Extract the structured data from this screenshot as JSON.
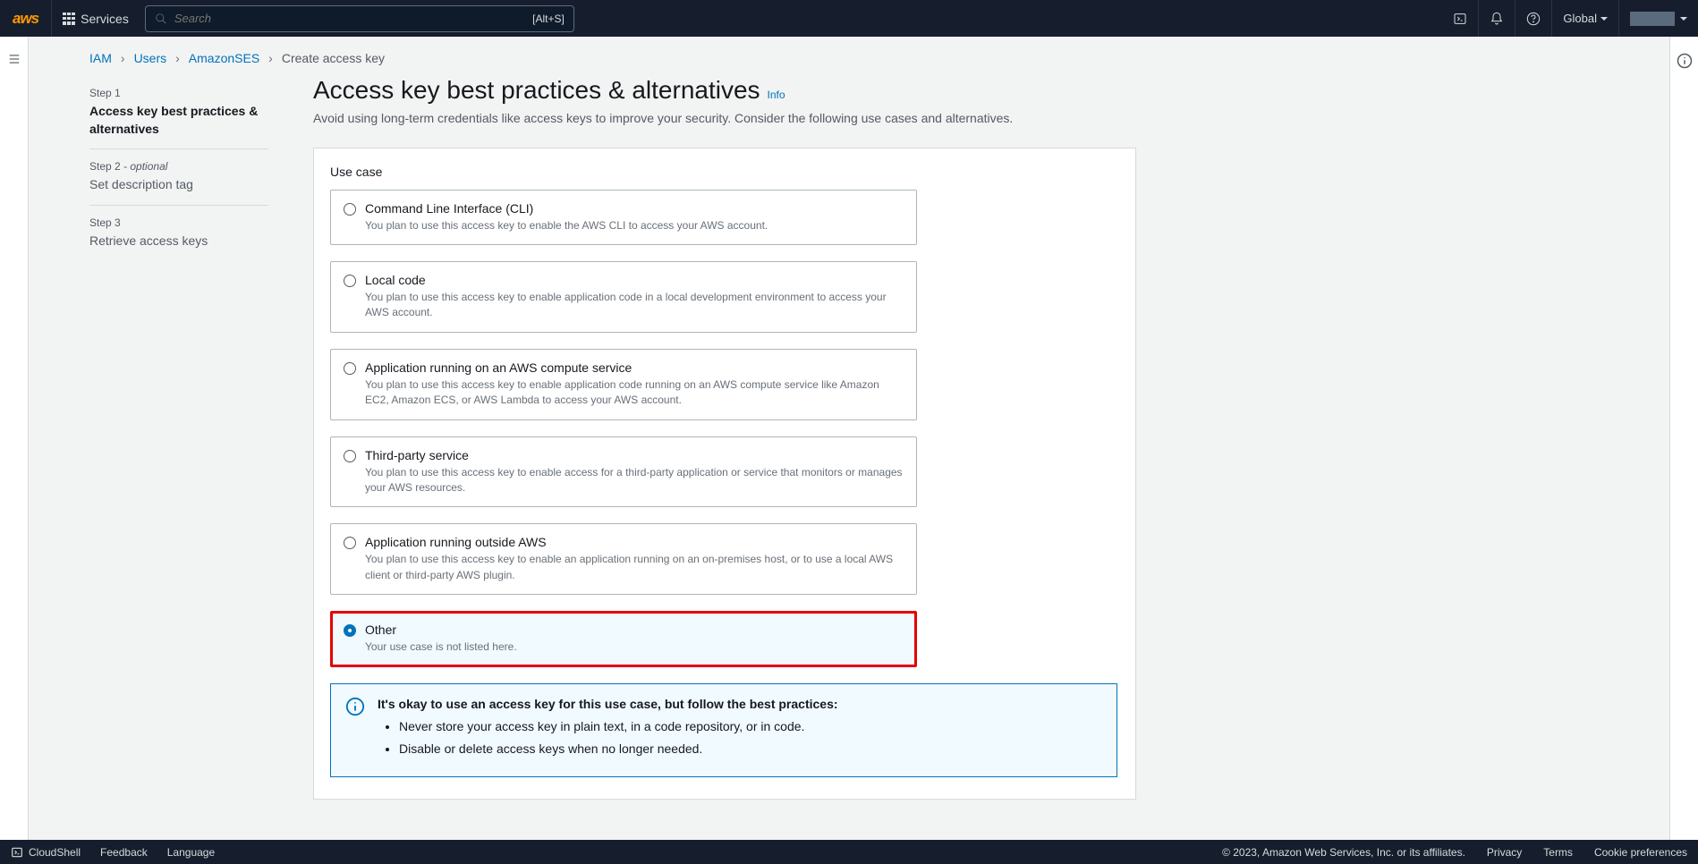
{
  "nav": {
    "logo_text": "aws",
    "services_label": "Services",
    "search_placeholder": "Search",
    "search_shortcut": "[Alt+S]",
    "region_label": "Global"
  },
  "breadcrumb": {
    "items": [
      "IAM",
      "Users",
      "AmazonSES"
    ],
    "current": "Create access key"
  },
  "steps": [
    {
      "num": "Step 1",
      "optional": "",
      "title": "Access key best practices & alternatives",
      "active": true
    },
    {
      "num": "Step 2",
      "optional": " - optional",
      "title": "Set description tag",
      "active": false
    },
    {
      "num": "Step 3",
      "optional": "",
      "title": "Retrieve access keys",
      "active": false
    }
  ],
  "page": {
    "title": "Access key best practices & alternatives",
    "info_label": "Info",
    "description": "Avoid using long-term credentials like access keys to improve your security. Consider the following use cases and alternatives."
  },
  "use_case": {
    "heading": "Use case",
    "options": [
      {
        "title": "Command Line Interface (CLI)",
        "desc": "You plan to use this access key to enable the AWS CLI to access your AWS account.",
        "selected": false
      },
      {
        "title": "Local code",
        "desc": "You plan to use this access key to enable application code in a local development environment to access your AWS account.",
        "selected": false
      },
      {
        "title": "Application running on an AWS compute service",
        "desc": "You plan to use this access key to enable application code running on an AWS compute service like Amazon EC2, Amazon ECS, or AWS Lambda to access your AWS account.",
        "selected": false
      },
      {
        "title": "Third-party service",
        "desc": "You plan to use this access key to enable access for a third-party application or service that monitors or manages your AWS resources.",
        "selected": false
      },
      {
        "title": "Application running outside AWS",
        "desc": "You plan to use this access key to enable an application running on an on-premises host, or to use a local AWS client or third-party AWS plugin.",
        "selected": false
      },
      {
        "title": "Other",
        "desc": "Your use case is not listed here.",
        "selected": true
      }
    ]
  },
  "info_box": {
    "title": "It's okay to use an access key for this use case, but follow the best practices:",
    "bullets": [
      "Never store your access key in plain text, in a code repository, or in code.",
      "Disable or delete access keys when no longer needed."
    ]
  },
  "footer": {
    "cloudshell": "CloudShell",
    "feedback": "Feedback",
    "language": "Language",
    "copyright": "© 2023, Amazon Web Services, Inc. or its affiliates.",
    "privacy": "Privacy",
    "terms": "Terms",
    "cookies": "Cookie preferences"
  }
}
